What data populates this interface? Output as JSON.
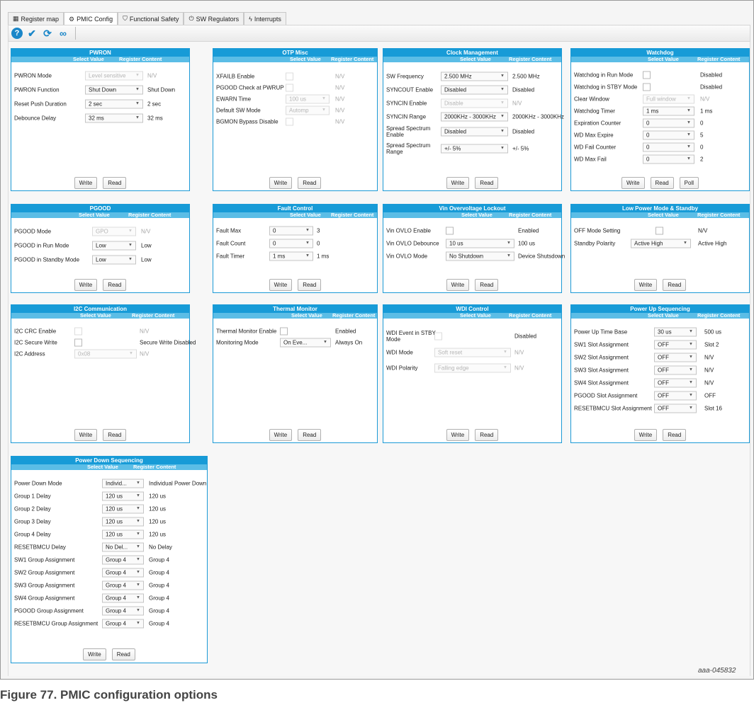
{
  "tabs": [
    {
      "label": "Register map",
      "icon": "grid-icon"
    },
    {
      "label": "PMIC Config",
      "icon": "gear-icon"
    },
    {
      "label": "Functional Safety",
      "icon": "shield-check-icon"
    },
    {
      "label": "SW Regulators",
      "icon": "power-icon"
    },
    {
      "label": "Interrupts",
      "icon": "lightning-icon"
    }
  ],
  "active_tab": "PMIC Config",
  "toolbar": {
    "help": "?",
    "write_all": "check-icon",
    "refresh": "refresh-icon",
    "continuous": "infinity-icon"
  },
  "headers": {
    "select": "Select Value",
    "register": "Register Content"
  },
  "buttons": {
    "write": "Write",
    "read": "Read",
    "poll": "Poll"
  },
  "pwron": {
    "title": "PWRON",
    "rows": [
      {
        "label": "PWRON Mode",
        "value": "Level sensitive",
        "reg": "N/V"
      },
      {
        "label": "PWRON Function",
        "value": "Shut Down",
        "reg": "Shut Down"
      },
      {
        "label": "Reset Push Duration",
        "value": "2 sec",
        "reg": "2 sec"
      },
      {
        "label": "Debounce Delay",
        "value": "32 ms",
        "reg": "32 ms"
      }
    ]
  },
  "otp": {
    "title": "OTP Misc",
    "rows": [
      {
        "label": "XFAILB Enable",
        "reg": "N/V"
      },
      {
        "label": "PGOOD Check at PWRUP",
        "reg": "N/V"
      },
      {
        "label": "EWARN Time",
        "value": "100 us",
        "reg": "N/V"
      },
      {
        "label": "Default SW Mode",
        "value": "Automp",
        "reg": "N/V"
      },
      {
        "label": "BGMON Bypass Disable",
        "reg": "N/V"
      }
    ]
  },
  "clock": {
    "title": "Clock Management",
    "rows": [
      {
        "label": "SW Frequency",
        "value": "2.500 MHz",
        "reg": "2.500 MHz"
      },
      {
        "label": "SYNCOUT Enable",
        "value": "Disabled",
        "reg": "Disabled"
      },
      {
        "label": "SYNCIN Enable",
        "value": "Disable",
        "reg": "N/V"
      },
      {
        "label": "SYNCIN Range",
        "value": "2000KHz - 3000KHz",
        "reg": "2000KHz - 3000KHz"
      },
      {
        "label": "Spread Spectrum Enable",
        "value": "Disabled",
        "reg": "Disabled"
      },
      {
        "label": "Spread Spectrum Range",
        "value": "+/- 5%",
        "reg": "+/- 5%"
      }
    ]
  },
  "watchdog": {
    "title": "Watchdog",
    "rows": [
      {
        "label": "Watchdog in Run Mode",
        "reg": "Disabled"
      },
      {
        "label": "Watchdog in STBY Mode",
        "reg": "Disabled"
      },
      {
        "label": "Clear Window",
        "value": "Full window",
        "reg": "N/V"
      },
      {
        "label": "Watchdog Timer",
        "value": "1 ms",
        "reg": "1 ms"
      },
      {
        "label": "Expiration Counter",
        "value": "0",
        "reg": "0"
      },
      {
        "label": "WD Max Expire",
        "value": "0",
        "reg": "5"
      },
      {
        "label": "WD Fail Counter",
        "value": "0",
        "reg": "0"
      },
      {
        "label": "WD Max Fail",
        "value": "0",
        "reg": "2"
      }
    ]
  },
  "pgood": {
    "title": "PGOOD",
    "rows": [
      {
        "label": "PGOOD Mode",
        "value": "GPO",
        "reg": "N/V"
      },
      {
        "label": "PGOOD in Run Mode",
        "value": "Low",
        "reg": "Low"
      },
      {
        "label": "PGOOD in Standby Mode",
        "value": "Low",
        "reg": "Low"
      }
    ]
  },
  "fault": {
    "title": "Fault Control",
    "rows": [
      {
        "label": "Fault Max",
        "value": "0",
        "reg": "3"
      },
      {
        "label": "Fault Count",
        "value": "0",
        "reg": "0"
      },
      {
        "label": "Fault Timer",
        "value": "1 ms",
        "reg": "1 ms"
      }
    ]
  },
  "vin": {
    "title": "Vin Overvoltage Lockout",
    "rows": [
      {
        "label": "Vin OVLO Enable",
        "reg": "Enabled"
      },
      {
        "label": "Vin OVLO Debounce",
        "value": "10 us",
        "reg": "100 us"
      },
      {
        "label": "Vin OVLO Mode",
        "value": "No Shutdown",
        "reg": "Device Shutsdown"
      }
    ]
  },
  "lowpower": {
    "title": "Low Power Mode & Standby",
    "rows": [
      {
        "label": "OFF Mode Setting",
        "reg": "N/V"
      },
      {
        "label": "Standby Polarity",
        "value": "Active High",
        "reg": "Active High"
      }
    ]
  },
  "i2c": {
    "title": "I2C Communication",
    "rows": [
      {
        "label": "I2C CRC Enable",
        "reg": "N/V"
      },
      {
        "label": "I2C Secure Write",
        "reg": "Secure Write Disabled"
      },
      {
        "label": "I2C Address",
        "value": "0x08",
        "reg": "N/V"
      }
    ]
  },
  "thermal": {
    "title": "Thermal Monitor",
    "rows": [
      {
        "label": "Thermal Monitor Enable",
        "reg": "Enabled"
      },
      {
        "label": "Monitoring Mode",
        "value": "On Eve...",
        "reg": "Always On"
      }
    ]
  },
  "wdi": {
    "title": "WDI Control",
    "rows": [
      {
        "label": "WDI Event in STBY Mode",
        "reg": "Disabled"
      },
      {
        "label": "WDI Mode",
        "value": "Soft reset",
        "reg": "N/V"
      },
      {
        "label": "WDI Polarity",
        "value": "Falling edge",
        "reg": "N/V"
      }
    ]
  },
  "powerup": {
    "title": "Power Up Sequencing",
    "rows": [
      {
        "label": "Power Up Time Base",
        "value": "30 us",
        "reg": "500 us"
      },
      {
        "label": "SW1 Slot Assignment",
        "value": "OFF",
        "reg": "Slot 2"
      },
      {
        "label": "SW2 Slot Assignment",
        "value": "OFF",
        "reg": "N/V"
      },
      {
        "label": "SW3 Slot Assignment",
        "value": "OFF",
        "reg": "N/V"
      },
      {
        "label": "SW4 Slot Assignment",
        "value": "OFF",
        "reg": "N/V"
      },
      {
        "label": "PGOOD Slot Assignment",
        "value": "OFF",
        "reg": "OFF"
      },
      {
        "label": "RESETBMCU Slot Assignment",
        "value": "OFF",
        "reg": "Slot 16"
      }
    ]
  },
  "powerdown": {
    "title": "Power Down Sequencing",
    "rows": [
      {
        "label": "Power Down Mode",
        "value": "Individ...",
        "reg": "Individual Power Down"
      },
      {
        "label": "Group 1 Delay",
        "value": "120 us",
        "reg": "120 us"
      },
      {
        "label": "Group 2 Delay",
        "value": "120 us",
        "reg": "120 us"
      },
      {
        "label": "Group 3 Delay",
        "value": "120 us",
        "reg": "120 us"
      },
      {
        "label": "Group 4 Delay",
        "value": "120 us",
        "reg": "120 us"
      },
      {
        "label": "RESETBMCU Delay",
        "value": "No Del...",
        "reg": "No Delay"
      },
      {
        "label": "SW1 Group Assignment",
        "value": "Group 4",
        "reg": "Group 4"
      },
      {
        "label": "SW2 Group Assignment",
        "value": "Group 4",
        "reg": "Group 4"
      },
      {
        "label": "SW3 Group Assignment",
        "value": "Group 4",
        "reg": "Group 4"
      },
      {
        "label": "SW4 Group Assignment",
        "value": "Group 4",
        "reg": "Group 4"
      },
      {
        "label": "PGOOD Group Assignment",
        "value": "Group 4",
        "reg": "Group 4"
      },
      {
        "label": "RESETBMCU Group Assignment",
        "value": "Group 4",
        "reg": "Group 4"
      }
    ]
  },
  "figure_id": "aaa-045832",
  "caption": "Figure 77.  PMIC configuration options"
}
